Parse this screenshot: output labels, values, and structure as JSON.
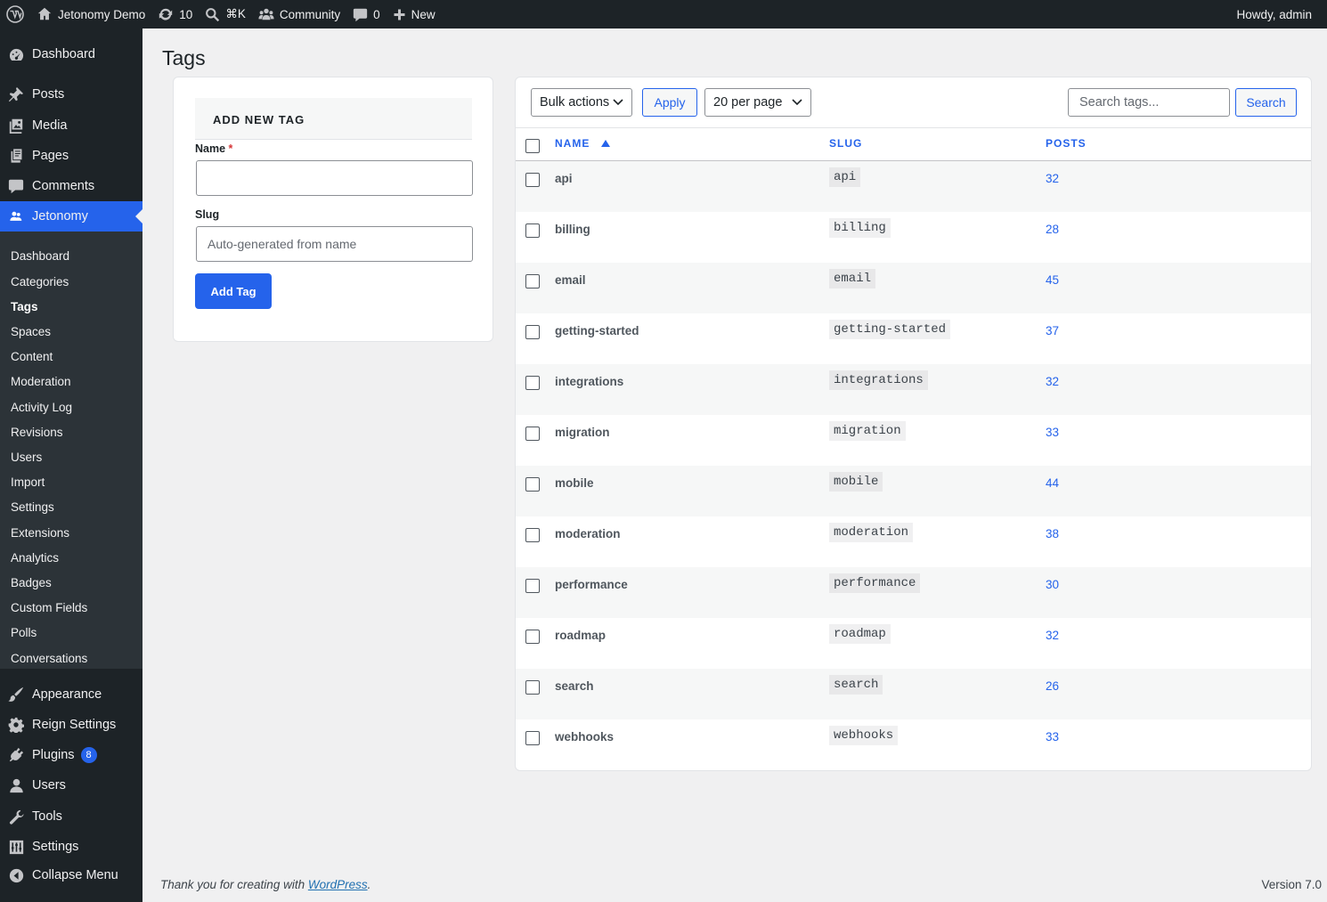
{
  "adminbar": {
    "site_name": "Jetonomy Demo",
    "updates_count": "10",
    "shortcut": "⌘K",
    "community": "Community",
    "comments_count": "0",
    "new_label": "New",
    "howdy": "Howdy, admin"
  },
  "sidebar": {
    "dashboard": "Dashboard",
    "posts": "Posts",
    "media": "Media",
    "pages": "Pages",
    "comments": "Comments",
    "jetonomy": "Jetonomy",
    "submenu": [
      "Dashboard",
      "Categories",
      "Tags",
      "Spaces",
      "Content",
      "Moderation",
      "Activity Log",
      "Revisions",
      "Users",
      "Import",
      "Settings",
      "Extensions",
      "Analytics",
      "Badges",
      "Custom Fields",
      "Polls",
      "Conversations"
    ],
    "appearance": "Appearance",
    "reign_settings": "Reign Settings",
    "plugins": "Plugins",
    "plugins_badge": "8",
    "users": "Users",
    "tools": "Tools",
    "settings": "Settings",
    "collapse": "Collapse Menu"
  },
  "page": {
    "title": "Tags"
  },
  "add_form": {
    "heading": "ADD NEW TAG",
    "name_label": "Name",
    "required_mark": "*",
    "name_value": "",
    "slug_label": "Slug",
    "slug_placeholder": "Auto-generated from name",
    "submit_label": "Add Tag"
  },
  "list": {
    "bulk_actions": "Bulk actions",
    "apply": "Apply",
    "per_page": "20 per page",
    "search_placeholder": "Search tags...",
    "search_button": "Search",
    "columns": {
      "name": "NAME",
      "slug": "SLUG",
      "posts": "POSTS"
    },
    "sort": "ascending",
    "rows": [
      {
        "name": "api",
        "slug": "api",
        "posts": "32"
      },
      {
        "name": "billing",
        "slug": "billing",
        "posts": "28"
      },
      {
        "name": "email",
        "slug": "email",
        "posts": "45"
      },
      {
        "name": "getting-started",
        "slug": "getting-started",
        "posts": "37"
      },
      {
        "name": "integrations",
        "slug": "integrations",
        "posts": "32"
      },
      {
        "name": "migration",
        "slug": "migration",
        "posts": "33"
      },
      {
        "name": "mobile",
        "slug": "mobile",
        "posts": "44"
      },
      {
        "name": "moderation",
        "slug": "moderation",
        "posts": "38"
      },
      {
        "name": "performance",
        "slug": "performance",
        "posts": "30"
      },
      {
        "name": "roadmap",
        "slug": "roadmap",
        "posts": "32"
      },
      {
        "name": "search",
        "slug": "search",
        "posts": "26"
      },
      {
        "name": "webhooks",
        "slug": "webhooks",
        "posts": "33"
      }
    ]
  },
  "footer": {
    "thanks_prefix": "Thank you for creating with ",
    "wp_link": "WordPress",
    "thanks_suffix": ".",
    "version": "Version 7.0"
  },
  "colors": {
    "accent": "#2563eb",
    "sidebar_bg": "#1d2327",
    "submenu_bg": "#2c3338",
    "page_bg": "#f0f0f1"
  }
}
